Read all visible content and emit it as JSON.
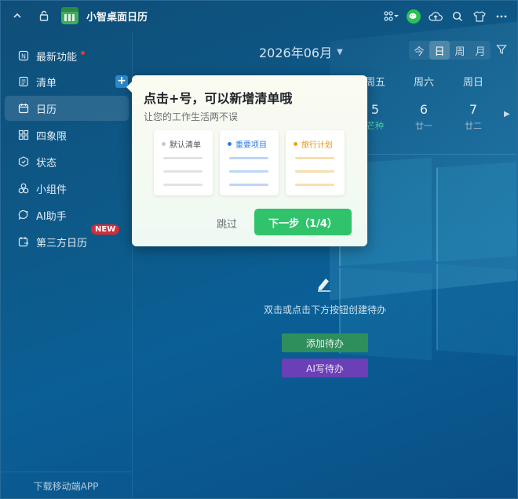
{
  "app": {
    "title": "小智桌面日历"
  },
  "titlebar": {
    "left_icons": [
      "chevron-up-icon",
      "lock-icon"
    ],
    "right_icons": [
      "apps-grid-icon",
      "wechat-icon",
      "cloud-upload-icon",
      "search-icon",
      "shirt-icon",
      "more-icon"
    ]
  },
  "sidebar": {
    "items": [
      {
        "label": "最新功能",
        "icon": "new-feature-icon"
      },
      {
        "label": "清单",
        "icon": "list-icon"
      },
      {
        "label": "日历",
        "icon": "calendar-icon"
      },
      {
        "label": "四象限",
        "icon": "quadrant-icon"
      },
      {
        "label": "状态",
        "icon": "status-icon"
      },
      {
        "label": "小组件",
        "icon": "widget-icon"
      },
      {
        "label": "AI助手",
        "icon": "ai-assistant-icon"
      },
      {
        "label": "第三方日历",
        "icon": "third-party-calendar-icon"
      }
    ],
    "new_badge": "NEW",
    "add_label": "+",
    "footer": "下载移动端APP"
  },
  "calendar": {
    "month": "2026年06月",
    "views": [
      "今",
      "日",
      "周",
      "月"
    ],
    "active_view": "日",
    "weekdays": [
      "周五",
      "周六",
      "周日"
    ],
    "days": [
      "5",
      "6",
      "7"
    ],
    "lunar": [
      "芒种",
      "廿一",
      "廿二"
    ]
  },
  "empty": {
    "message": "双击或点击下方按钮创建待办",
    "add_button": "添加待办",
    "ai_button": "AI写待办"
  },
  "popover": {
    "title": "点击+号，可以新增清单哦",
    "subtitle": "让您的工作生活两不误",
    "cards": [
      {
        "label": "默认清单",
        "color": "#c7c7c7",
        "line_color": "#e2e2e2"
      },
      {
        "label": "重要项目",
        "color": "#2f7bea",
        "line_color": "#bcd6f7"
      },
      {
        "label": "旅行计划",
        "color": "#f1a21c",
        "line_color": "#f8dfae"
      }
    ],
    "skip": "跳过",
    "next": "下一步（1/4）"
  },
  "colors": {
    "accent_green": "#31c36c",
    "add_green": "#2f8f5c",
    "ai_purple": "#6b3fb6",
    "badge_red": "#d62b3a"
  }
}
